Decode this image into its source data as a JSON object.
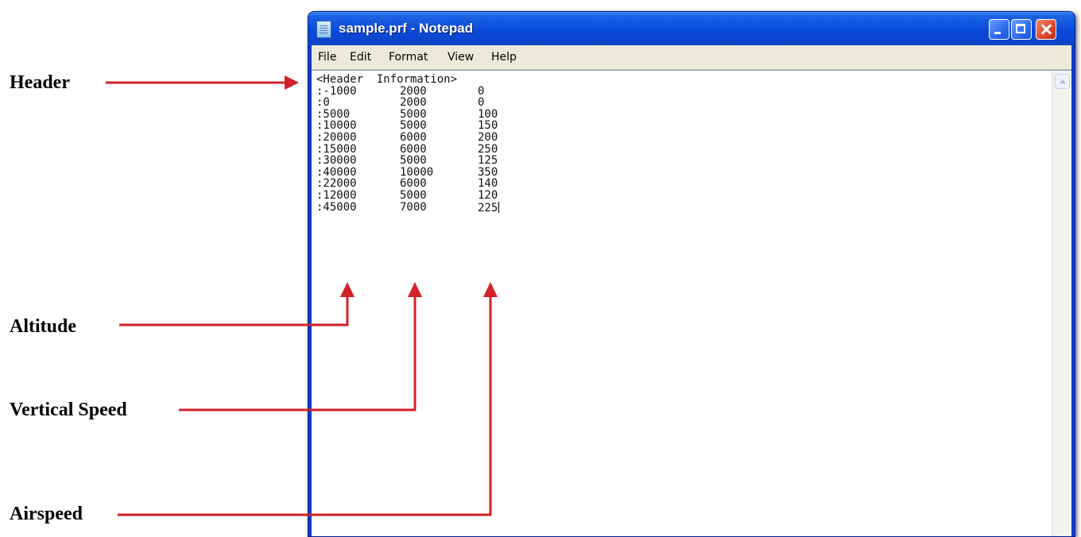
{
  "callouts": {
    "header": "Header",
    "altitude": "Altitude",
    "vertical_speed": "Vertical Speed",
    "airspeed": "Airspeed"
  },
  "window": {
    "title": "sample.prf - Notepad",
    "icon": "notepad-icon"
  },
  "menu": {
    "file": "File",
    "edit": "Edit",
    "format": "Format",
    "view": "View",
    "help": "Help"
  },
  "document": {
    "header_line": "<Header  Information>",
    "rows": [
      {
        "altitude": ":-1000",
        "vertical_speed": "2000",
        "airspeed": "0"
      },
      {
        "altitude": ":0",
        "vertical_speed": "2000",
        "airspeed": "0"
      },
      {
        "altitude": ":5000",
        "vertical_speed": "5000",
        "airspeed": "100"
      },
      {
        "altitude": ":10000",
        "vertical_speed": "5000",
        "airspeed": "150"
      },
      {
        "altitude": ":20000",
        "vertical_speed": "6000",
        "airspeed": "200"
      },
      {
        "altitude": ":15000",
        "vertical_speed": "6000",
        "airspeed": "250"
      },
      {
        "altitude": ":30000",
        "vertical_speed": "5000",
        "airspeed": "125"
      },
      {
        "altitude": ":40000",
        "vertical_speed": "10000",
        "airspeed": "350"
      },
      {
        "altitude": ":22000",
        "vertical_speed": "6000",
        "airspeed": "140"
      },
      {
        "altitude": ":12000",
        "vertical_speed": "5000",
        "airspeed": "120"
      },
      {
        "altitude": ":45000",
        "vertical_speed": "7000",
        "airspeed": "225"
      }
    ]
  },
  "colors": {
    "arrow": "#d42027",
    "titlebar": "#0b4bd8",
    "menubar": "#ece9d8"
  }
}
